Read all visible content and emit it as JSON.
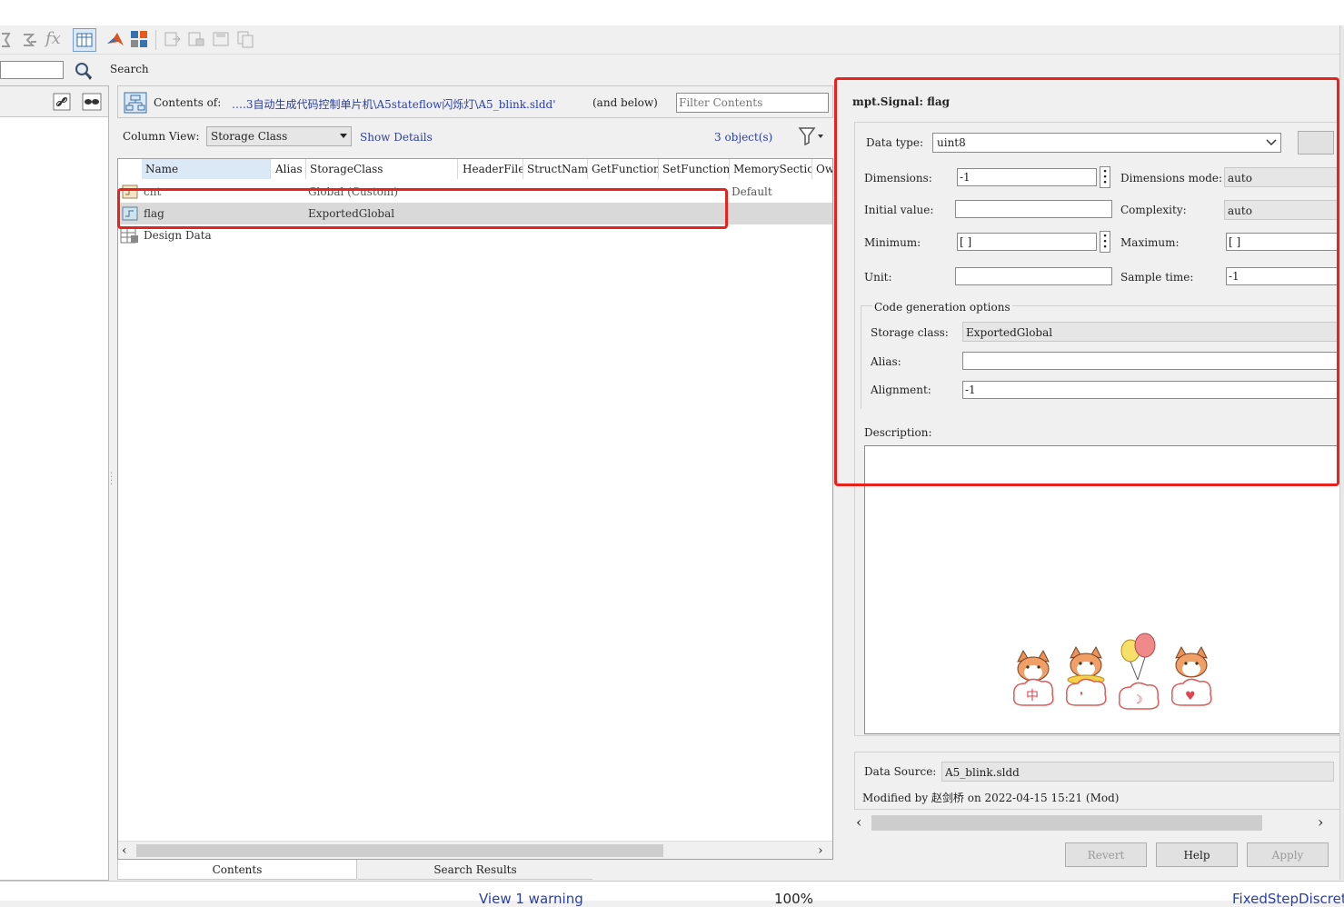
{
  "toolbar": {
    "icons": [
      "step-icon",
      "function-icon",
      "fx-icon",
      "column-view-icon",
      "matlab-icon",
      "layout-icon",
      "export-icon",
      "import-icon",
      "save-icon",
      "copy-icon"
    ],
    "fx_label": "fx"
  },
  "search": {
    "value": "",
    "label": "Search"
  },
  "contents": {
    "prefix": "Contents of:",
    "path": "….3自动生成代码控制单片机\\A5stateflow闪烁灯\\A5_blink.sldd'",
    "scope": "(and below)",
    "filter_placeholder": "Filter Contents",
    "column_view_label": "Column View:",
    "column_view_value": "Storage Class",
    "show_details": "Show Details",
    "object_count": "3 object(s)",
    "columns": [
      "Name",
      "Alias",
      "StorageClass",
      "HeaderFile",
      "StructName",
      "GetFunction",
      "SetFunction",
      "MemorySection",
      "Owner"
    ],
    "rows": [
      {
        "name": "cnt",
        "storage_class": "Global (Custom)",
        "memory_section": "Default"
      },
      {
        "name": "flag",
        "storage_class": "ExportedGlobal",
        "memory_section": ""
      },
      {
        "name": "Design Data",
        "storage_class": "",
        "memory_section": ""
      }
    ],
    "tabs": [
      "Contents",
      "Search Results"
    ]
  },
  "props": {
    "title": "mpt.Signal: flag",
    "data_type_label": "Data type:",
    "data_type_value": "uint8",
    "dimensions_label": "Dimensions:",
    "dimensions_value": "-1",
    "dimensions_mode_label": "Dimensions mode:",
    "dimensions_mode_value": "auto",
    "initial_value_label": "Initial value:",
    "initial_value": "",
    "complexity_label": "Complexity:",
    "complexity_value": "auto",
    "minimum_label": "Minimum:",
    "minimum_value": "[ ]",
    "maximum_label": "Maximum:",
    "maximum_value": "[ ]",
    "unit_label": "Unit:",
    "unit_value": "",
    "sample_time_label": "Sample time:",
    "sample_time_value": "-1",
    "codegen_label": "Code generation options",
    "storage_class_label": "Storage class:",
    "storage_class_value": "ExportedGlobal",
    "alias_label": "Alias:",
    "alias_value": "",
    "alignment_label": "Alignment:",
    "alignment_value": "-1",
    "description_label": "Description:",
    "description_value": "",
    "data_source_label": "Data Source:",
    "data_source_value": "A5_blink.sldd",
    "modified_by": "Modified by 赵剑桥 on 2022-04-15 15:21 (Mod)",
    "buttons": {
      "revert": "Revert",
      "help": "Help",
      "apply": "Apply"
    },
    "sticker_glyphs": [
      "中",
      "❜",
      "☽",
      "♥"
    ]
  },
  "status": {
    "warning": "View 1 warning",
    "zoom": "100%",
    "solver": "FixedStepDiscrete"
  },
  "colors": {
    "highlight": "#e8231e",
    "link": "#2a3ea8",
    "selected_row": "#d9d9d9",
    "name_header": "#dbe8f5"
  }
}
